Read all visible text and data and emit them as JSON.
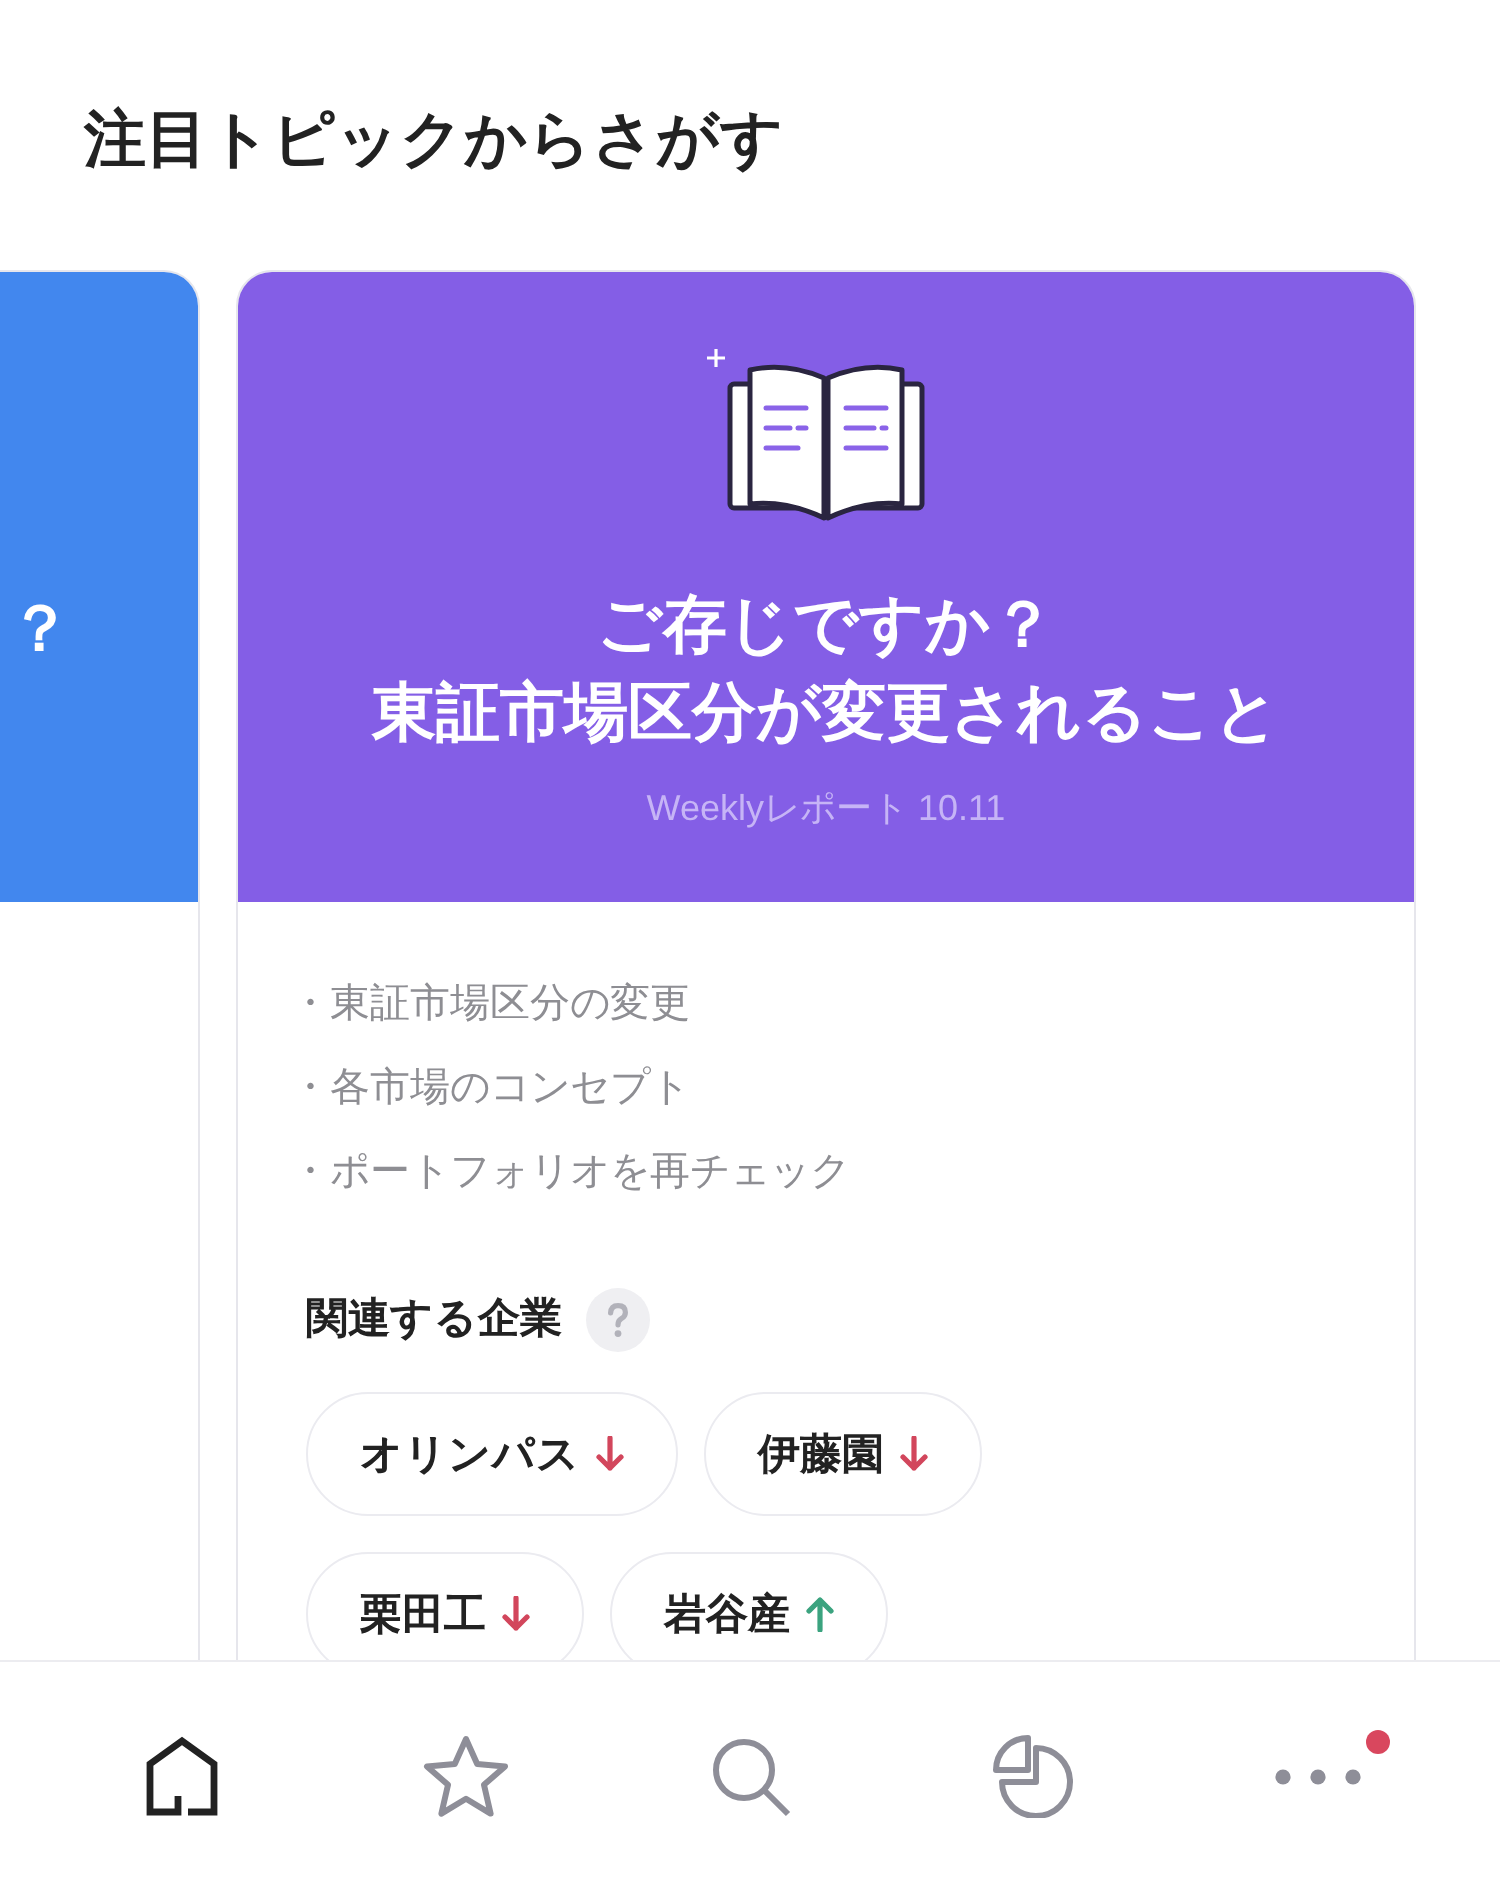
{
  "page_title": "注目トピックからさがす",
  "cards": [
    {
      "kind": "clipped",
      "color": "#4287ee",
      "title_lines": [
        "？"
      ]
    },
    {
      "kind": "full",
      "color": "#845ee6",
      "title_lines": [
        "ご存じですか？",
        "東証市場区分が変更されること"
      ],
      "subtitle": "Weeklyレポート 10.11",
      "bullets": [
        "・東証市場区分の変更",
        "・各市場のコンセプト",
        "・ポートフォリオを再チェック"
      ],
      "related": {
        "heading": "関連する企業",
        "companies": [
          {
            "name": "オリンパス",
            "rising": false
          },
          {
            "name": "伊藤園",
            "rising": false
          },
          {
            "name": "栗田工",
            "rising": false
          },
          {
            "name": "岩谷産",
            "rising": true
          }
        ]
      }
    }
  ],
  "bottom_nav": [
    {
      "kind": "home",
      "selected": true,
      "badge": false
    },
    {
      "kind": "star",
      "selected": false,
      "badge": false
    },
    {
      "kind": "search",
      "selected": false,
      "badge": false
    },
    {
      "kind": "chart",
      "selected": false,
      "badge": false
    },
    {
      "kind": "more",
      "selected": false,
      "badge": true
    }
  ]
}
